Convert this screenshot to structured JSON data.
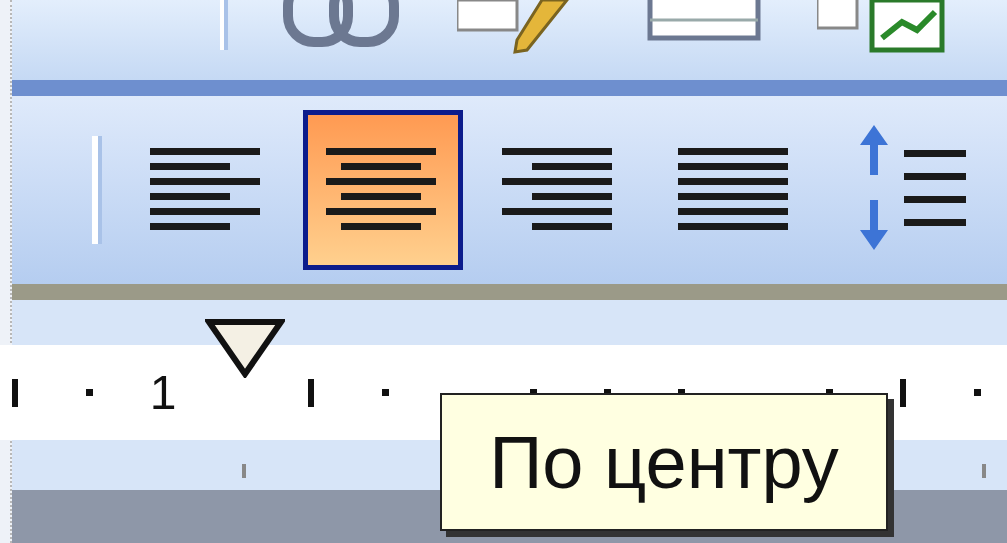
{
  "top_toolbar": {
    "icons": [
      {
        "kind": "link"
      },
      {
        "kind": "pencil"
      },
      {
        "kind": "table"
      },
      {
        "kind": "chart"
      }
    ]
  },
  "align_buttons": [
    {
      "kind": "left",
      "selected": false
    },
    {
      "kind": "center",
      "selected": true
    },
    {
      "kind": "right",
      "selected": false
    },
    {
      "kind": "justify",
      "selected": false
    },
    {
      "kind": "spacing",
      "selected": false
    }
  ],
  "ruler": {
    "label": "1"
  },
  "tooltip": {
    "text": "По центру"
  }
}
